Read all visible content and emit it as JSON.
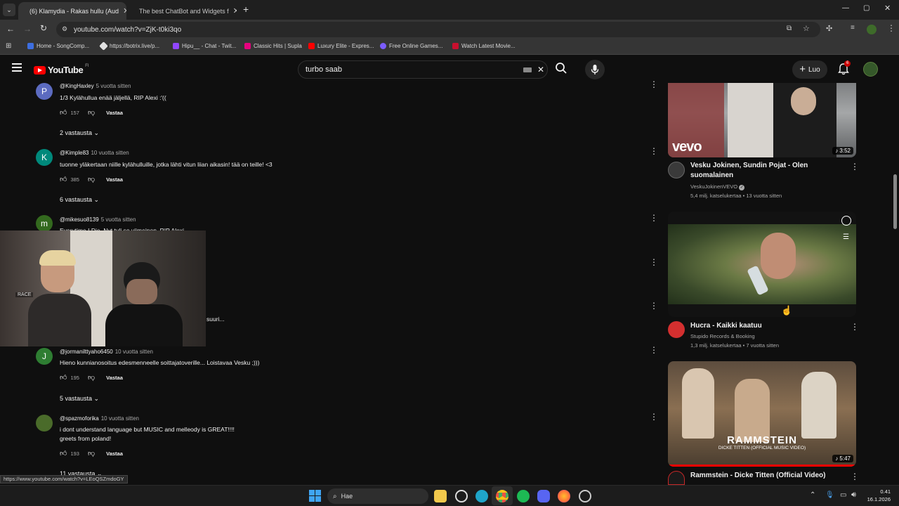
{
  "browser": {
    "tabs": [
      {
        "title": "(6) Klamydia - Rakas hullu (Aud",
        "active": true
      },
      {
        "title": "The best ChatBot and Widgets f",
        "active": false
      }
    ],
    "url": "youtube.com/watch?v=ZjK-t0ki3qo",
    "status_url": "https://www.youtube.com/watch?v=LEoQSZmdoGY",
    "bookmarks": [
      {
        "label": "Home - SongComp...",
        "color": "#3d6ee0"
      },
      {
        "label": "https://botrix.live/p...",
        "color": "#e0e0e0"
      },
      {
        "label": "Hipu__ - Chat - Twit...",
        "color": "#9146ff"
      },
      {
        "label": "Classic Hits | Supla",
        "color": "#e6007e"
      },
      {
        "label": "Luxury Elite - Expres...",
        "color": "#ff0000"
      },
      {
        "label": "Free Online Games...",
        "color": "#7b5cff"
      },
      {
        "label": "Watch Latest Movie...",
        "color": "#c8102e"
      }
    ]
  },
  "youtube": {
    "logo": "YouTube",
    "region": "FI",
    "search_value": "turbo saab",
    "create_label": "Luo",
    "notif_count": "6"
  },
  "comments": [
    {
      "author": "@KingHaxley",
      "age": "5 vuotta sitten",
      "avatar_letter": "P",
      "avatar_color": "#5c6bc0",
      "text": "1/3 Kylähullua enää jäljellä, RIP Alexi :'((",
      "likes": "157",
      "reply": "Vastaa",
      "replies": "2 vastausta"
    },
    {
      "author": "@Kimple83",
      "age": "10 vuotta sitten",
      "avatar_letter": "K",
      "avatar_color": "#00897b",
      "text": "tuonne yläkertaan niille kylähulluille, jotka lähti vitun liian aikasin! tää on teille! <3",
      "likes": "385",
      "reply": "Vastaa",
      "replies": "6 vastausta"
    },
    {
      "author": "@mikesuo8139",
      "age": "5 vuotta sitten",
      "avatar_letter": "m",
      "avatar_color": "#33691e",
      "text": "Everytime I Die. Nyt tuli se viimeinen, RIP Alexi",
      "partial_text": "suuri..."
    },
    {
      "author": "@jormanilttyaho6450",
      "age": "10 vuotta sitten",
      "avatar_letter": "J",
      "avatar_color": "#2e7d32",
      "text": "Hieno kunnianosoitus edesmenneelle soittajatoverille... Loistavaa Vesku ;)))",
      "likes": "195",
      "reply": "Vastaa",
      "replies": "5 vastausta"
    },
    {
      "author": "@spazmoforika",
      "age": "10 vuotta sitten",
      "avatar_letter": "",
      "avatar_color": "#4a6b2a",
      "text": "i dont understand language but MUSIC and melleody is GREAT!!!!",
      "text2": "greets from poland!",
      "likes": "193",
      "reply": "Vastaa",
      "replies": "11 vastausta"
    }
  ],
  "webcam_label": "RACE",
  "sidebar": [
    {
      "title": "Vesku Jokinen, Sundin Pojat - Olen suomalainen",
      "channel": "VeskuJokinenVEVO",
      "meta": "5,4 milj. katselukertaa • 13 vuotta sitten",
      "duration": "3:52",
      "watermark": "vevo"
    },
    {
      "title": "Hucra - Kaikki kaatuu",
      "channel": "Stupido Records & Booking",
      "meta": "1,3 milj. katselukertaa • 7 vuotta sitten"
    },
    {
      "title": "Rammstein - Dicke Titten (Official Video)",
      "duration": "5:47",
      "overlay_title": "RAMMSTEIN",
      "overlay_sub": "DICKE TITTEN (OFFICIAL MUSIC VIDEO)"
    }
  ],
  "taskbar": {
    "search_placeholder": "Hae",
    "time": "0.41",
    "date": "16.1.2026"
  }
}
